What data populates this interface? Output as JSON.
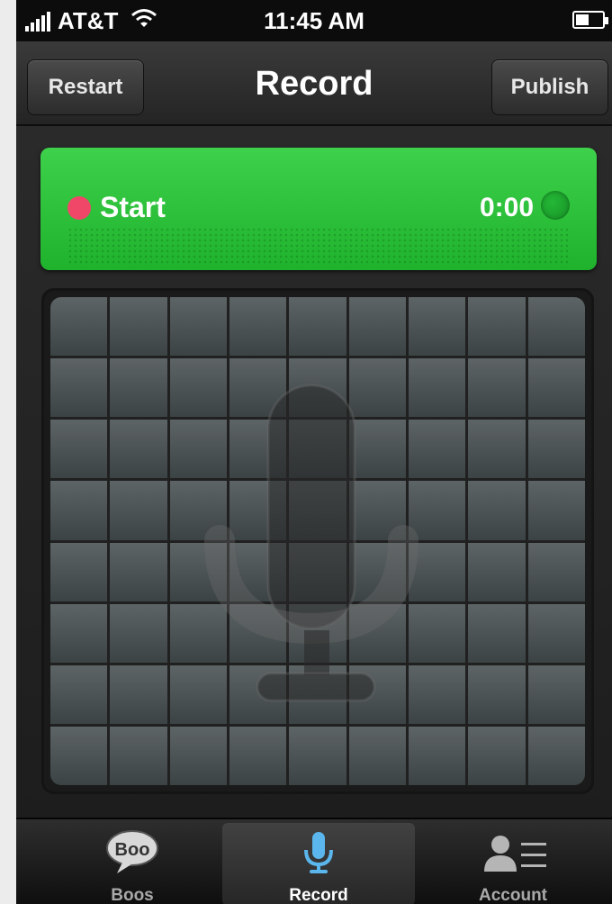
{
  "status_bar": {
    "carrier": "AT&T",
    "time": "11:45 AM"
  },
  "nav": {
    "title": "Record",
    "left_button": "Restart",
    "right_button": "Publish"
  },
  "recorder": {
    "action_label": "Start",
    "elapsed": "0:00",
    "accent_color": "#2cc13a",
    "record_dot_color": "#f04668"
  },
  "tabs": [
    {
      "label": "Boos",
      "icon": "boo-bubble-icon"
    },
    {
      "label": "Record",
      "icon": "microphone-icon",
      "selected": true
    },
    {
      "label": "Account",
      "icon": "account-list-icon"
    }
  ],
  "boo_logo_text": "Boo"
}
